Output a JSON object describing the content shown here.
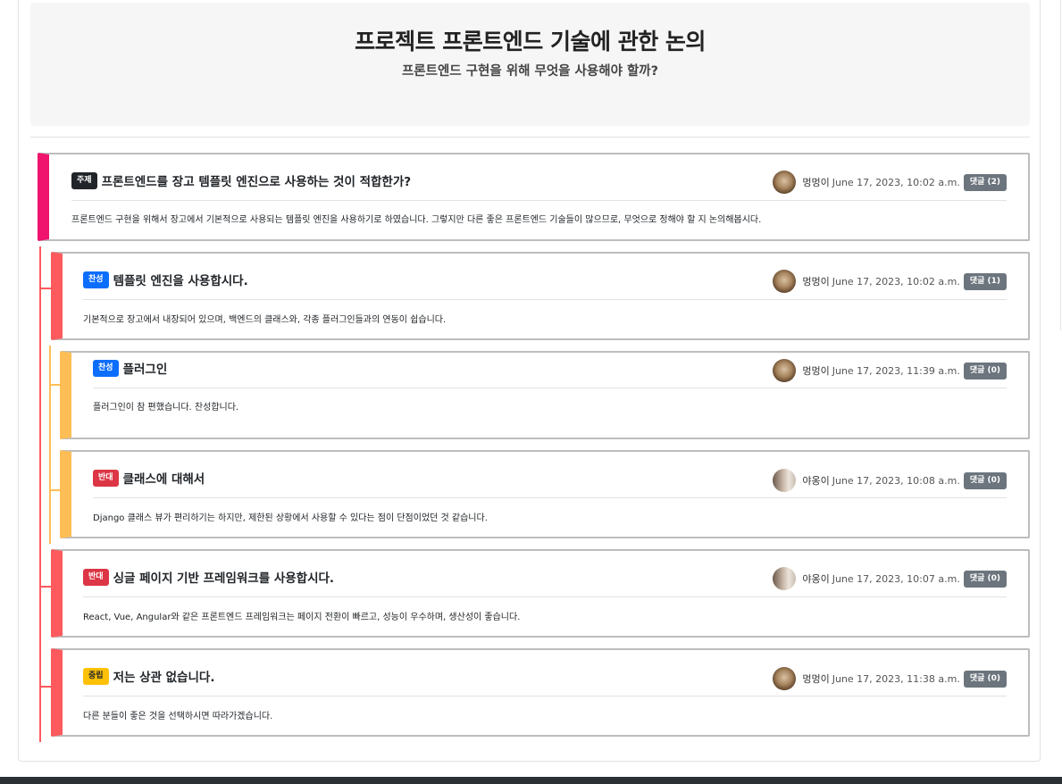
{
  "hero": {
    "title": "프로젝트 프론트엔드 기술에 관한 논의",
    "subtitle": "프론트엔드 구현을 위해 무엇을 사용해야 할까?"
  },
  "colors": {
    "topic_accent": "#f0146e",
    "opinion_accent": "#fd5a5d",
    "reply_accent": "#ffbe55",
    "badge_pro": "#0d6efd",
    "badge_con": "#dc3545",
    "badge_neutral": "#ffc107",
    "badge_topic": "#212529",
    "comment_button": "#6c757d"
  },
  "topic": {
    "badge": "주제",
    "title": "프론트엔드를 장고 템플릿 엔진으로 사용하는 것이 적합한가?",
    "author": "멍멍이",
    "date": "June 17, 2023, 10:02 a.m.",
    "comments": "댓글 (2)",
    "body": "프론트엔드 구현을 위해서 장고에서 기본적으로 사용되는 템플릿 엔진을 사용하기로 하였습니다. 그렇지만 다른 좋은 프론트엔드 기술들이 많으므로, 무엇으로 정해야 할 지 논의해봅시다."
  },
  "opinions": [
    {
      "badge": "찬성",
      "title": "템플릿 엔진을 사용합시다.",
      "author": "멍멍이",
      "date": "June 17, 2023, 10:02 a.m.",
      "comments": "댓글 (1)",
      "body": "기본적으로 장고에서 내장되어 있으며, 백엔드의 클래스와, 각종 플러그인들과의 연동이 쉽습니다."
    },
    {
      "badge": "찬성",
      "title": "플러그인",
      "author": "멍멍이",
      "date": "June 17, 2023, 11:39 a.m.",
      "comments": "댓글 (0)",
      "body": "플러그인이 참 편했습니다. 찬성합니다."
    },
    {
      "badge": "반대",
      "title": "클래스에 대해서",
      "author": "야옹이",
      "date": "June 17, 2023, 10:08 a.m.",
      "comments": "댓글 (0)",
      "body": "Django 클래스 뷰가 편리하기는 하지만, 제한된 상황에서 사용할 수 있다는 점이 단점이었던 것 같습니다."
    },
    {
      "badge": "반대",
      "title": "싱글 페이지 기반 프레임워크를 사용합시다.",
      "author": "야옹이",
      "date": "June 17, 2023, 10:07 a.m.",
      "comments": "댓글 (0)",
      "body": "React, Vue, Angular와 같은 프론트엔드 프레임워크는 페이지 전환이 빠르고, 성능이 우수하며, 생산성이 좋습니다."
    },
    {
      "badge": "중립",
      "title": "저는 상관 없습니다.",
      "author": "멍멍이",
      "date": "June 17, 2023, 11:38 a.m.",
      "comments": "댓글 (0)",
      "body": "다른 분들이 좋은 것을 선택하시면 따라가겠습니다."
    }
  ]
}
